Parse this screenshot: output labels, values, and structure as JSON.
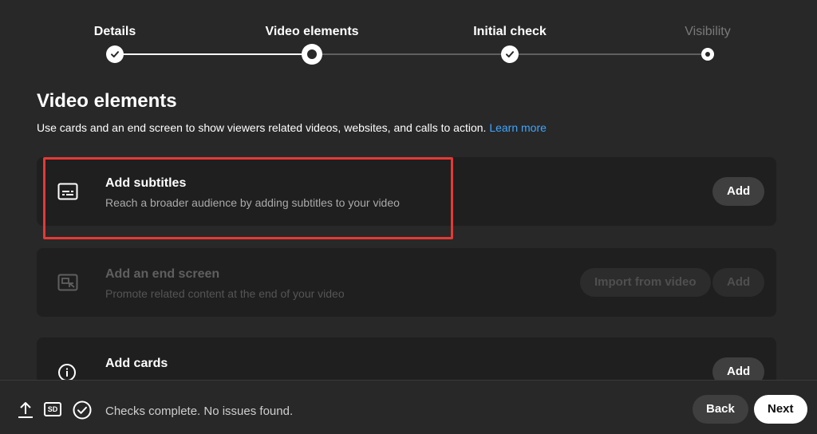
{
  "stepper": {
    "steps": [
      {
        "label": "Details",
        "state": "done"
      },
      {
        "label": "Video elements",
        "state": "current"
      },
      {
        "label": "Initial check",
        "state": "done"
      },
      {
        "label": "Visibility",
        "state": "todo"
      }
    ]
  },
  "main": {
    "title": "Video elements",
    "description": "Use cards and an end screen to show viewers related videos, websites, and calls to action.",
    "learn_more": "Learn more"
  },
  "cards": {
    "subtitles": {
      "title": "Add subtitles",
      "subtitle": "Reach a broader audience by adding subtitles to your video",
      "button": "Add",
      "icon": "subtitles-icon"
    },
    "end_screen": {
      "title": "Add an end screen",
      "subtitle": "Promote related content at the end of your video",
      "import_button": "Import from video",
      "button": "Add",
      "icon": "end-screen-icon"
    },
    "cards": {
      "title": "Add cards",
      "button": "Add",
      "icon": "info-icon"
    }
  },
  "footer": {
    "status": "Checks complete. No issues found.",
    "sd_badge": "SD",
    "back": "Back",
    "next": "Next"
  },
  "colors": {
    "background": "#282828",
    "card": "#1f1f1f",
    "link": "#3ea6ff",
    "highlight": "#e53935"
  }
}
